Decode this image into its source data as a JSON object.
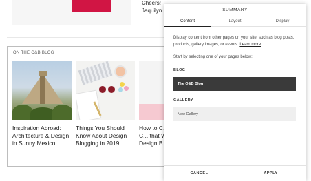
{
  "background": {
    "top_card_text": "Cheers!",
    "testimonial_lines": [
      "Cheers!",
      "Jaquilyn"
    ],
    "blog_section_label": "ON THE O&B BLOG",
    "posts": [
      {
        "title": "Inspiration Abroad: Architecture & Design in Sunny Mexico"
      },
      {
        "title": "Things You Should Know About Design Blogging in 2019"
      },
      {
        "title": "How to C... Editorial C... that Work... Design B..."
      }
    ]
  },
  "panel": {
    "title": "SUMMARY",
    "tabs": [
      {
        "label": "Content",
        "active": true
      },
      {
        "label": "Layout",
        "active": false
      },
      {
        "label": "Display",
        "active": false
      }
    ],
    "description": "Display content from other pages on your site, such as blog posts, products, gallery images, or events.",
    "learn_more": "Learn more",
    "start_text": "Start by selecting one of your pages below:",
    "sections": [
      {
        "label": "BLOG",
        "items": [
          {
            "label": "The O&B Blog",
            "selected": true
          }
        ]
      },
      {
        "label": "GALLERY",
        "items": [
          {
            "label": "New Gallery",
            "selected": false
          }
        ]
      }
    ],
    "cancel_label": "CANCEL",
    "apply_label": "APPLY"
  },
  "colors": {
    "accent_red": "#d11544",
    "selected_item": "#3a3a3a"
  }
}
